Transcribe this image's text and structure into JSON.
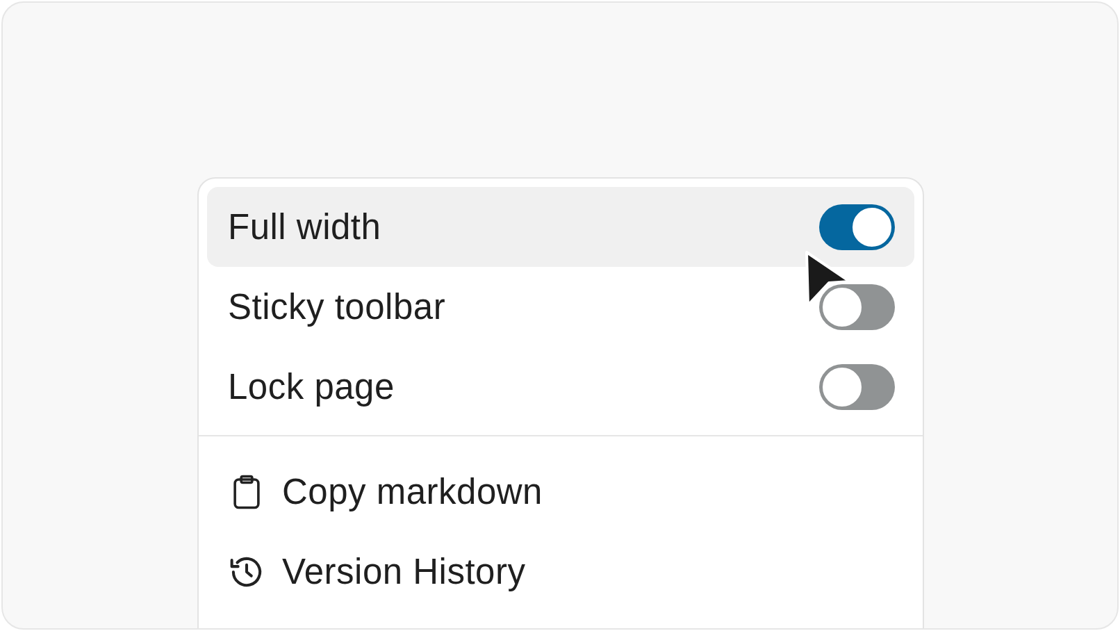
{
  "toggles": [
    {
      "label": "Full width",
      "on": true,
      "highlighted": true
    },
    {
      "label": "Sticky toolbar",
      "on": false,
      "highlighted": false
    },
    {
      "label": "Lock page",
      "on": false,
      "highlighted": false
    }
  ],
  "actions": [
    {
      "label": "Copy markdown",
      "kind": "clipboard"
    },
    {
      "label": "Version History",
      "kind": "history"
    }
  ]
}
